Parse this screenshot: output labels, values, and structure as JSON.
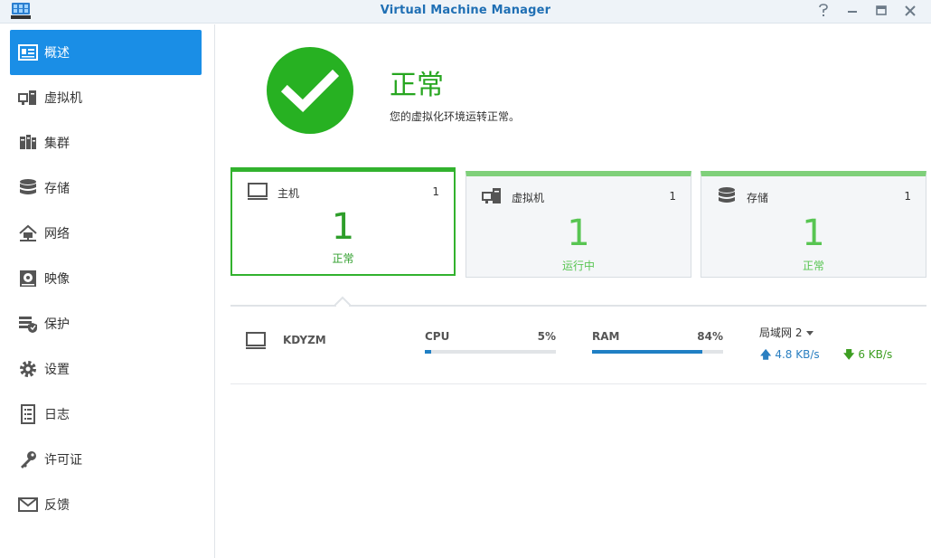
{
  "window": {
    "title": "Virtual Machine Manager"
  },
  "sidebar": {
    "items": [
      {
        "label": "概述",
        "icon": "overview-icon",
        "active": true
      },
      {
        "label": "虚拟机",
        "icon": "virtual-machine-icon"
      },
      {
        "label": "集群",
        "icon": "cluster-icon"
      },
      {
        "label": "存储",
        "icon": "storage-icon"
      },
      {
        "label": "网络",
        "icon": "network-icon"
      },
      {
        "label": "映像",
        "icon": "image-icon"
      },
      {
        "label": "保护",
        "icon": "protection-icon"
      },
      {
        "label": "设置",
        "icon": "gear-icon"
      },
      {
        "label": "日志",
        "icon": "log-icon"
      },
      {
        "label": "许可证",
        "icon": "license-key-icon"
      },
      {
        "label": "反馈",
        "icon": "feedback-mail-icon"
      }
    ]
  },
  "status": {
    "title": "正常",
    "description": "您的虚拟化环境运转正常。",
    "color": "#27b122"
  },
  "cards": [
    {
      "title": "主机",
      "count": "1",
      "big": "1",
      "status": "正常",
      "icon": "host-monitor-icon"
    },
    {
      "title": "虚拟机",
      "count": "1",
      "big": "1",
      "status": "运行中",
      "icon": "virtual-machine-icon"
    },
    {
      "title": "存储",
      "count": "1",
      "big": "1",
      "status": "正常",
      "icon": "storage-icon"
    }
  ],
  "host": {
    "name": "KDYZM",
    "cpu": {
      "label": "CPU",
      "value": "5%",
      "fraction": 0.05
    },
    "ram": {
      "label": "RAM",
      "value": "84%",
      "fraction": 0.84
    },
    "network": {
      "selected": "局域网 2",
      "upload": "4.8 KB/s",
      "download": "6 KB/s"
    }
  },
  "colors": {
    "accent": "#1a8ee6",
    "ok": "#27b122",
    "bar": "#1f7fc4"
  }
}
